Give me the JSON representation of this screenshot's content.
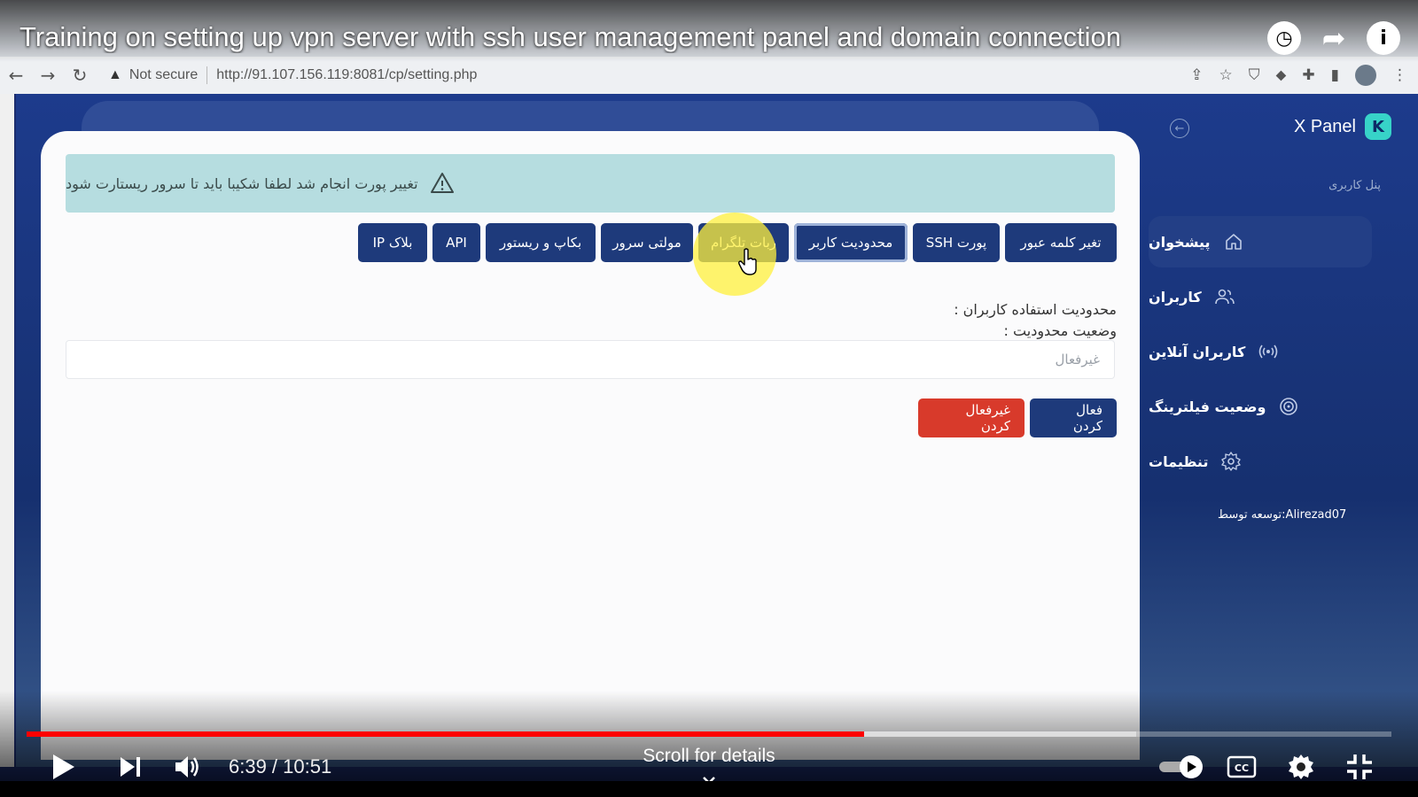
{
  "video": {
    "title": "Training on setting up vpn server with ssh user management panel and domain connection",
    "time": "6:39 / 10:51",
    "progress_fraction": 0.6139,
    "scroll_hint": "Scroll for details"
  },
  "browser": {
    "security_label": "Not secure",
    "url": "http://91.107.156.119:8081/cp/setting.php"
  },
  "sidebar": {
    "brand": "X Panel",
    "section_label": "پنل کاربری",
    "items": [
      {
        "label": "پیشخوان",
        "icon": "home-icon",
        "active": true
      },
      {
        "label": "کاربران",
        "icon": "users-icon"
      },
      {
        "label": "کاربران آنلاین",
        "icon": "broadcast-icon"
      },
      {
        "label": "وضعیت فیلترینگ",
        "icon": "target-icon"
      },
      {
        "label": "تنظیمات",
        "icon": "gear-icon"
      }
    ],
    "credit": "توسعه توسط:Alirezad07"
  },
  "alert": {
    "text": "تغییر پورت انجام شد لطفا شکیبا باید تا سرور ریستارت شود",
    "icon": "warning-icon"
  },
  "tabs": [
    {
      "label": "تغیر کلمه عبور"
    },
    {
      "label": "پورت SSH"
    },
    {
      "label": "محدودیت کاربر",
      "active": true
    },
    {
      "label": "ربات تلگرام"
    },
    {
      "label": "مولتی سرور"
    },
    {
      "label": "بکاپ و ریستور"
    },
    {
      "label": "API"
    },
    {
      "label": "بلاک IP"
    }
  ],
  "limit": {
    "heading": "محدودیت استفاده کاربران :",
    "status_label": "وضعیت محدودیت :",
    "status_value": "غیرفعال",
    "enable_label": "فعال کردن",
    "disable_label": "غیرفعال کردن"
  },
  "colors": {
    "accent": "#1e3a7b",
    "danger": "#d83a2b",
    "alert_bg": "#b6dde0",
    "progress": "#ff0000"
  }
}
